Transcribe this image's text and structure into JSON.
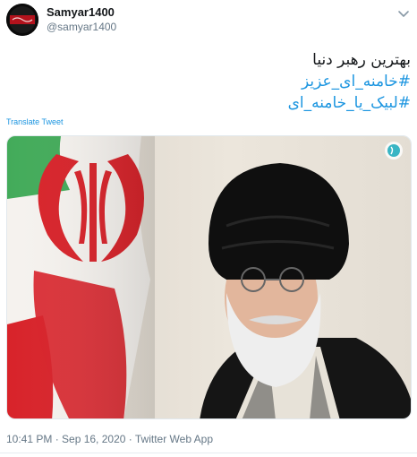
{
  "tweet": {
    "author_name": "Samyar1400",
    "author_handle": "@samyar1400",
    "text_lines": [
      {
        "text": "بهترین رهبر دنیا",
        "is_hashtag": false
      },
      {
        "text": "#خامنه_ای_عزیز",
        "is_hashtag": true
      },
      {
        "text": "#لبیک_یا_خامنه_ای",
        "is_hashtag": true
      }
    ],
    "translate_label": "Translate Tweet",
    "timestamp": "10:41 PM · Sep 16, 2020 · Twitter Web App"
  },
  "colors": {
    "link": "#1b95e0",
    "meta_text": "#657786",
    "flag_red": "#d8232a",
    "flag_green": "#239f40"
  },
  "icons": {
    "menu": "chevron-down-icon",
    "watermark": "khamenei-site-watermark"
  }
}
